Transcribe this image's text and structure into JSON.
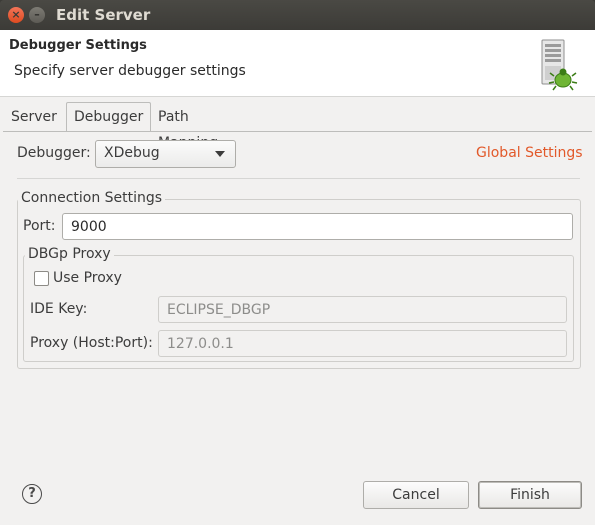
{
  "window": {
    "title": "Edit Server",
    "close_glyph": "×",
    "min_glyph": "–"
  },
  "header": {
    "title": "Debugger Settings",
    "description": "Specify server debugger settings",
    "icon": "server-bug-icon"
  },
  "tabs": [
    {
      "label": "Server",
      "active": false
    },
    {
      "label": "Debugger",
      "active": true
    },
    {
      "label": "Path Mapping",
      "active": false
    }
  ],
  "debugger": {
    "label": "Debugger:",
    "value": "XDebug"
  },
  "global_settings_link": "Global Settings",
  "connection": {
    "group_title": "Connection Settings",
    "port_label": "Port:",
    "port_value": "9000"
  },
  "proxy": {
    "group_title": "DBGp Proxy",
    "use_proxy_label": "Use Proxy",
    "use_proxy_checked": false,
    "ide_key_label": "IDE Key:",
    "ide_key_value": "ECLIPSE_DBGP",
    "host_port_label": "Proxy (Host:Port):",
    "host_port_value": "127.0.0.1"
  },
  "footer": {
    "help_glyph": "?",
    "cancel_label": "Cancel",
    "finish_label": "Finish"
  },
  "colors": {
    "link": "#e2592a",
    "titlebar": "#3c3b37",
    "close_button": "#de4b20"
  }
}
